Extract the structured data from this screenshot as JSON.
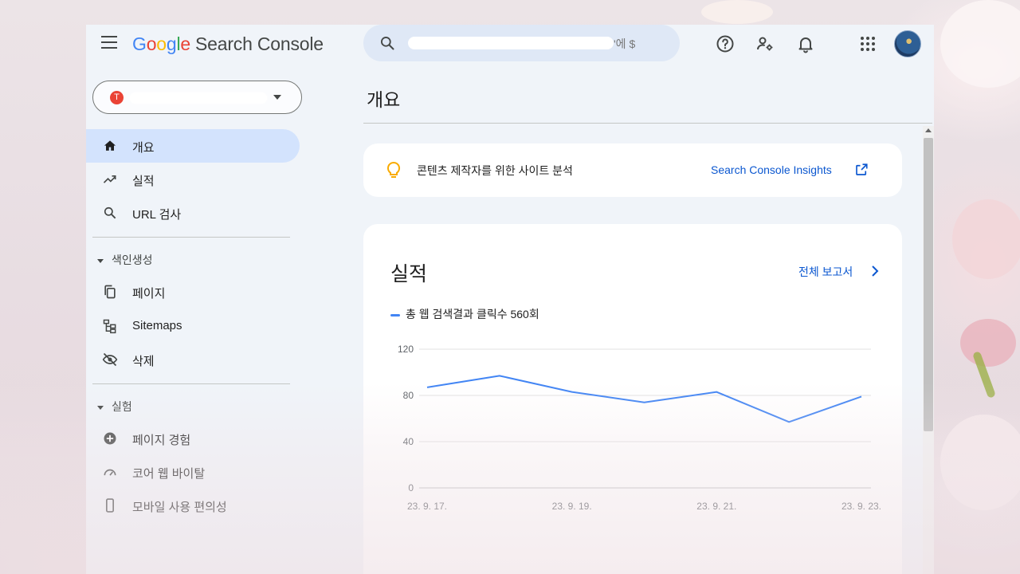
{
  "header": {
    "logo_parts": [
      "G",
      "o",
      "o",
      "g",
      "l",
      "e"
    ],
    "product": "Search Console",
    "search_tail": "'에 $"
  },
  "sidebar": {
    "property_icon": "T",
    "items": [
      {
        "label": "개요",
        "icon": "home-icon"
      },
      {
        "label": "실적",
        "icon": "trending-up-icon"
      },
      {
        "label": "URL 검사",
        "icon": "search-icon"
      }
    ],
    "index_section": "색인생성",
    "index_items": [
      {
        "label": "페이지",
        "icon": "pages-icon"
      },
      {
        "label": "Sitemaps",
        "icon": "sitemap-icon"
      },
      {
        "label": "삭제",
        "icon": "visibility-off-icon"
      }
    ],
    "exp_section": "실험",
    "exp_items": [
      {
        "label": "페이지 경험",
        "icon": "add-circle-icon"
      },
      {
        "label": "코어 웹 바이탈",
        "icon": "speed-icon"
      },
      {
        "label": "모바일 사용 편의성",
        "icon": "mobile-icon"
      }
    ]
  },
  "main": {
    "title": "개요",
    "insight_text": "콘텐츠 제작자를 위한 사이트 분석",
    "insight_link": "Search Console Insights",
    "performance_title": "실적",
    "full_report": "전체 보고서",
    "legend": "총 웹 검색결과 클릭수 560회"
  },
  "colors": {
    "accent": "#0b57d0",
    "line": "#4285f4",
    "active_nav": "#d3e3fd"
  },
  "chart_data": {
    "type": "line",
    "x": [
      "23. 9. 17.",
      "23. 9. 18.",
      "23. 9. 19.",
      "23. 9. 20.",
      "23. 9. 21.",
      "23. 9. 22.",
      "23. 9. 23."
    ],
    "x_tick_labels": [
      "23. 9. 17.",
      "23. 9. 19.",
      "23. 9. 21.",
      "23. 9. 23."
    ],
    "series": [
      {
        "name": "총 웹 검색결과 클릭수 560회",
        "values": [
          87,
          97,
          83,
          74,
          83,
          57,
          79
        ]
      }
    ],
    "yticks": [
      0,
      40,
      80,
      120
    ],
    "ylim": [
      0,
      120
    ],
    "grid": true
  }
}
